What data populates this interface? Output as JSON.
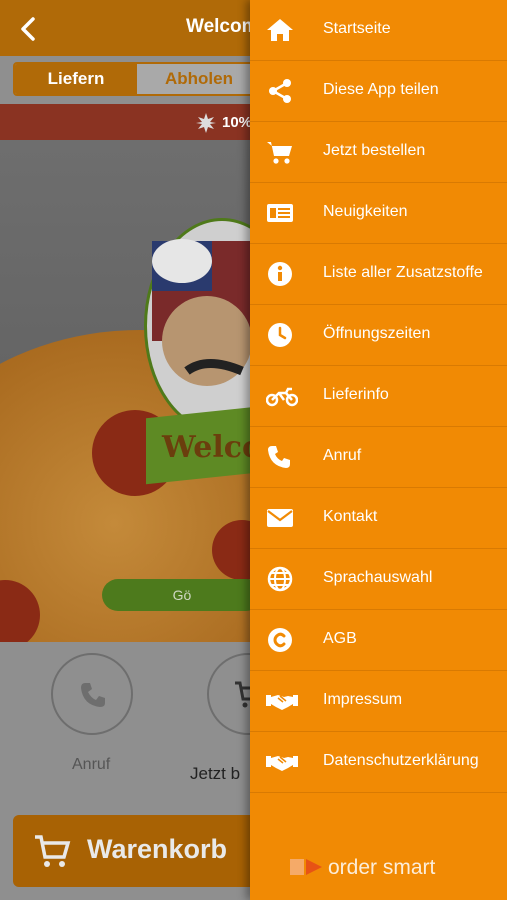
{
  "header": {
    "title": "Welcome",
    "back_icon": "chevron-left-icon"
  },
  "tabs": {
    "deliver_label": "Liefern",
    "pickup_label": "Abholen"
  },
  "promo": {
    "text": "10%"
  },
  "hero": {
    "banner_text": "Welcom",
    "button_label": "Gö"
  },
  "actions": {
    "call_label": "Anruf",
    "order_label": "Jetzt b"
  },
  "cart": {
    "label": "Warenkorb",
    "icon": "cart-icon"
  },
  "menu": {
    "items": [
      {
        "label": "Startseite",
        "icon": "home-icon"
      },
      {
        "label": "Diese App teilen",
        "icon": "share-icon"
      },
      {
        "label": "Jetzt bestellen",
        "icon": "cart-icon"
      },
      {
        "label": "Neuigkeiten",
        "icon": "newspaper-icon"
      },
      {
        "label": "Liste aller Zusatzstoffe",
        "icon": "info-icon"
      },
      {
        "label": "Öffnungszeiten",
        "icon": "clock-icon"
      },
      {
        "label": "Lieferinfo",
        "icon": "motorbike-icon"
      },
      {
        "label": "Anruf",
        "icon": "phone-icon"
      },
      {
        "label": "Kontakt",
        "icon": "mail-icon"
      },
      {
        "label": "Sprachauswahl",
        "icon": "globe-icon"
      },
      {
        "label": "AGB",
        "icon": "copyright-icon"
      },
      {
        "label": "Impressum",
        "icon": "handshake-icon"
      },
      {
        "label": "Datenschutzerklärung",
        "icon": "handshake-icon"
      }
    ]
  },
  "footer": {
    "logo_text": "order smart"
  },
  "colors": {
    "drawer": "#f18a04",
    "topbar_dimmed": "#b06a08",
    "promo_dimmed": "#8a3322"
  }
}
